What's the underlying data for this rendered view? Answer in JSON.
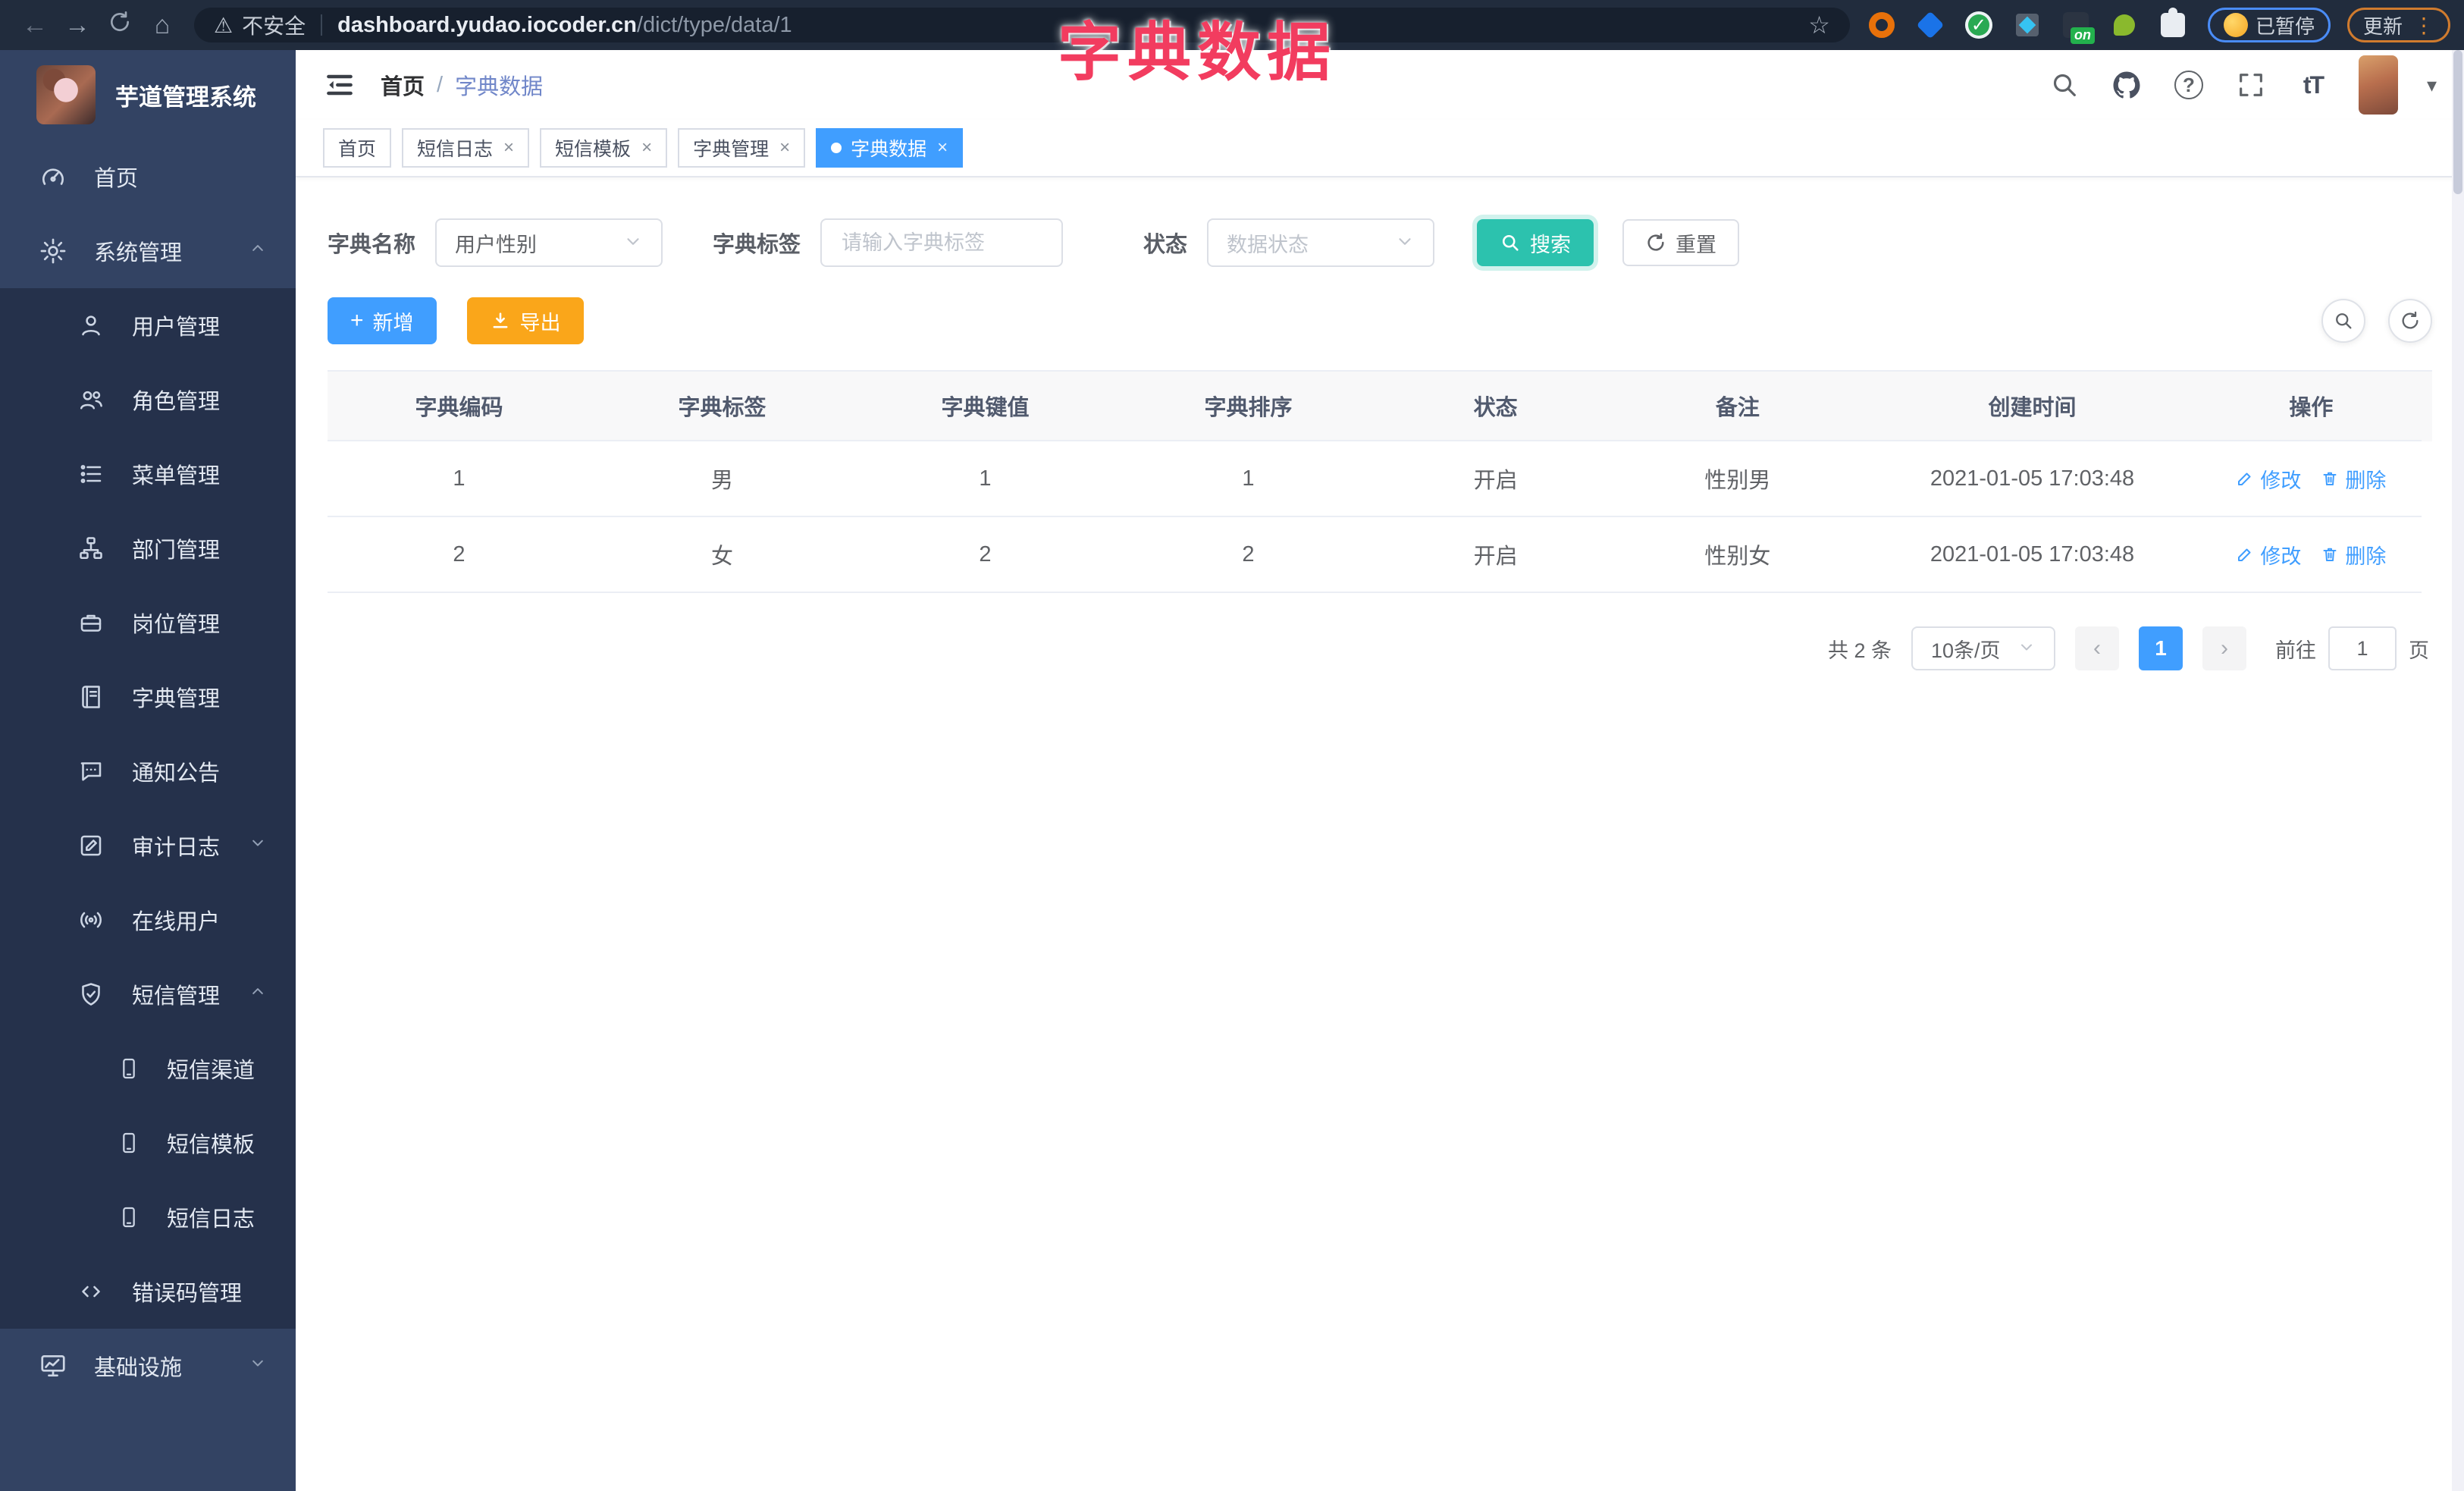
{
  "browser": {
    "security_label": "不安全",
    "url_domain": "dashboard.yudao.iocoder.cn",
    "url_path": "/dict/type/data/1",
    "extension_on_badge": "on",
    "paused_label": "已暂停",
    "update_label": "更新"
  },
  "glyphs": {
    "back": "←",
    "forward": "→",
    "home": "⌂",
    "star": "☆",
    "warning": "⚠",
    "check": "✓",
    "question": "?",
    "font_size": "tT",
    "caret_down": "▾",
    "dots_vertical": "⋮",
    "close": "×",
    "plus": "+",
    "prev": "‹",
    "next": "›"
  },
  "overlay": {
    "title": "字典数据"
  },
  "sidebar": {
    "logo_title": "芋道管理系统",
    "items": [
      {
        "label": "首页"
      },
      {
        "label": "系统管理"
      },
      {
        "label": "用户管理"
      },
      {
        "label": "角色管理"
      },
      {
        "label": "菜单管理"
      },
      {
        "label": "部门管理"
      },
      {
        "label": "岗位管理"
      },
      {
        "label": "字典管理"
      },
      {
        "label": "通知公告"
      },
      {
        "label": "审计日志"
      },
      {
        "label": "在线用户"
      },
      {
        "label": "短信管理"
      },
      {
        "label": "短信渠道"
      },
      {
        "label": "短信模板"
      },
      {
        "label": "短信日志"
      },
      {
        "label": "错误码管理"
      },
      {
        "label": "基础设施"
      }
    ]
  },
  "header": {
    "breadcrumb": {
      "home": "首页",
      "separator": "/",
      "current": "字典数据"
    }
  },
  "tabs": [
    {
      "label": "首页"
    },
    {
      "label": "短信日志"
    },
    {
      "label": "短信模板"
    },
    {
      "label": "字典管理"
    },
    {
      "label": "字典数据"
    }
  ],
  "filters": {
    "dict_name_label": "字典名称",
    "dict_name_value": "用户性别",
    "dict_label_label": "字典标签",
    "dict_label_placeholder": "请输入字典标签",
    "status_label": "状态",
    "status_placeholder": "数据状态",
    "search_label": "搜索",
    "reset_label": "重置"
  },
  "toolbar": {
    "add_label": "新增",
    "export_label": "导出"
  },
  "table": {
    "headers": [
      "字典编码",
      "字典标签",
      "字典键值",
      "字典排序",
      "状态",
      "备注",
      "创建时间",
      "操作"
    ],
    "rows": [
      {
        "code": "1",
        "label": "男",
        "value": "1",
        "sort": "1",
        "status": "开启",
        "remark": "性别男",
        "created": "2021-01-05 17:03:48",
        "edit": "修改",
        "delete": "删除"
      },
      {
        "code": "2",
        "label": "女",
        "value": "2",
        "sort": "2",
        "status": "开启",
        "remark": "性别女",
        "created": "2021-01-05 17:03:48",
        "edit": "修改",
        "delete": "删除"
      }
    ]
  },
  "pagination": {
    "total": "共 2 条",
    "page_size": "10条/页",
    "current_page": "1",
    "goto_label": "前往",
    "goto_value": "1",
    "page_suffix": "页"
  },
  "colors": {
    "primary": "#409eff",
    "search_teal": "#2cc2ae",
    "export_orange": "#faa61a",
    "overlay_pink": "#f23c5f",
    "sidebar_bg": "#334363",
    "submenu_bg": "#25314b"
  }
}
